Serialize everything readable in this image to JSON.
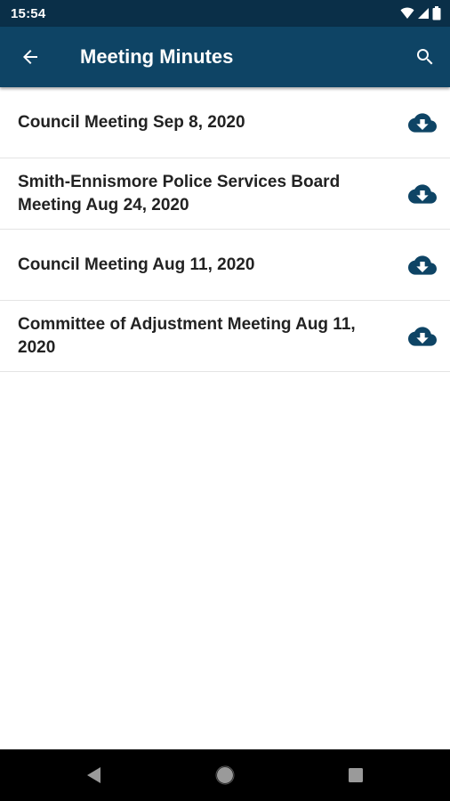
{
  "status_bar": {
    "time": "15:54",
    "icons": [
      "wifi-icon",
      "signal-icon",
      "battery-icon"
    ]
  },
  "app_bar": {
    "title": "Meeting Minutes",
    "back_icon": "arrow-back-icon",
    "search_icon": "search-icon"
  },
  "minutes": [
    {
      "title": "Council Meeting Sep 8, 2020",
      "icon": "cloud-download-icon"
    },
    {
      "title": "Smith-Ennismore Police Services Board Meeting Aug 24, 2020",
      "icon": "cloud-download-icon"
    },
    {
      "title": "Council Meeting Aug 11, 2020",
      "icon": "cloud-download-icon"
    },
    {
      "title": "Committee of Adjustment Meeting Aug 11, 2020",
      "icon": "cloud-download-icon"
    }
  ],
  "nav_bar": {
    "icons": [
      "back-triangle-icon",
      "home-circle-icon",
      "recents-square-icon"
    ]
  },
  "colors": {
    "status_bar": "#0a2f48",
    "app_bar": "#0e4465",
    "accent": "#0e4465",
    "text": "#222222"
  }
}
